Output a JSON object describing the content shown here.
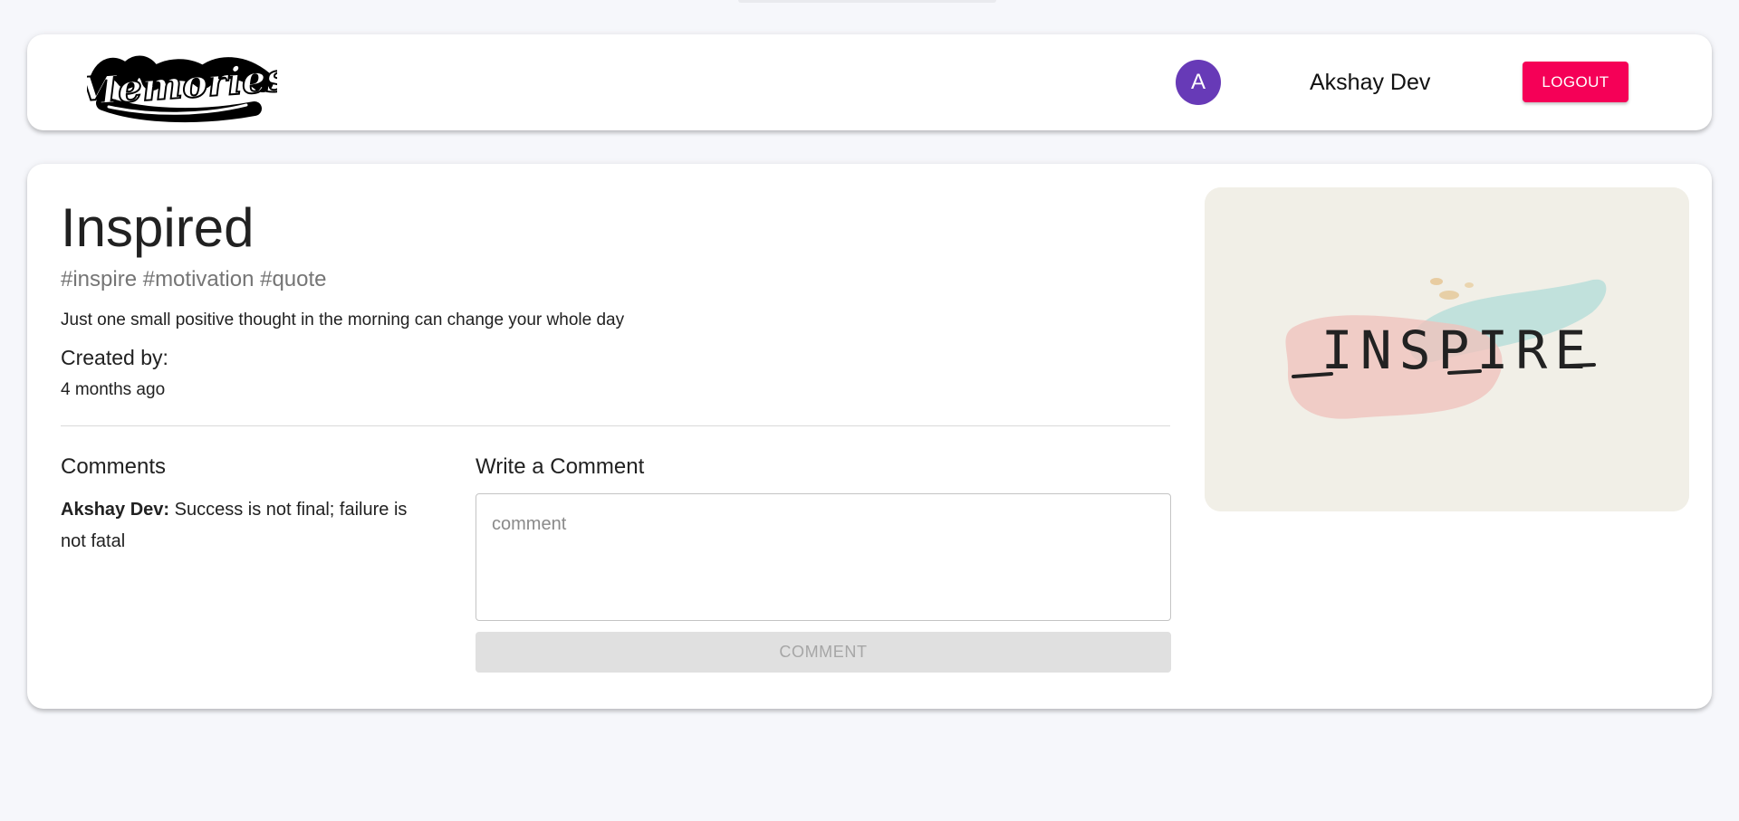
{
  "header": {
    "brand": "Memories",
    "avatar_initial": "A",
    "user_name": "Akshay Dev",
    "logout_label": "LOGOUT"
  },
  "post": {
    "title": "Inspired",
    "tags": "#inspire #motivation #quote",
    "message": "Just one small positive thought in the morning can change your whole day",
    "created_by_label": "Created by:",
    "created_at": "4 months ago",
    "image_text": "INSPIRE"
  },
  "comments": {
    "heading": "Comments",
    "items": [
      {
        "author": "Akshay Dev:",
        "text": " Success is not final; failure is not fatal"
      }
    ]
  },
  "write_comment": {
    "heading": "Write a Comment",
    "placeholder": "comment",
    "value": "",
    "submit_label": "COMMENT"
  },
  "colors": {
    "background": "#f6f7fb",
    "avatar": "#673ab7",
    "logout": "#f50057",
    "disabled_button": "#e0e0e0"
  },
  "icons": {
    "brand_logo": "memories-logo",
    "post_image": "inspire-watercolor-image"
  }
}
